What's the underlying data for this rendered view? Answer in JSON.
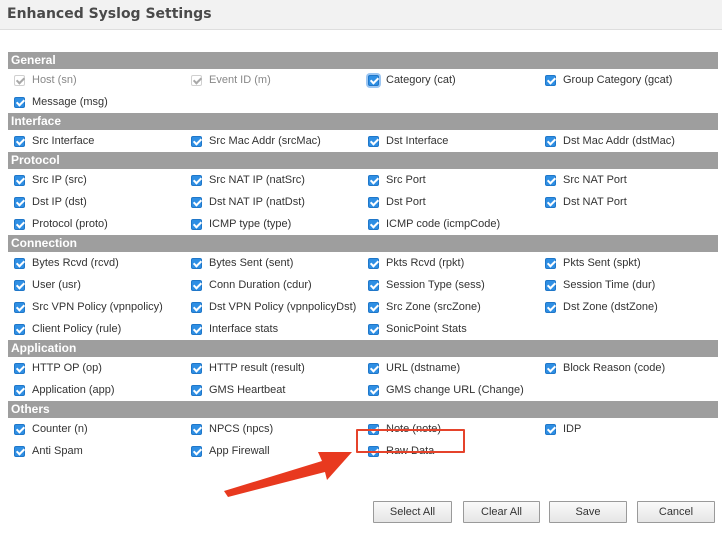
{
  "window": {
    "title": "Enhanced Syslog Settings"
  },
  "colors": {
    "accent": "#2f8fe4",
    "section_header": "#9e9e9e",
    "highlight": "#e5432b"
  },
  "sections": [
    {
      "name": "General",
      "rows": [
        [
          {
            "label": "Host (sn)",
            "checked": true,
            "disabled": true
          },
          {
            "label": "Event ID (m)",
            "checked": true,
            "disabled": true
          },
          {
            "label": "Category (cat)",
            "checked": true,
            "focused": true
          },
          {
            "label": "Group Category (gcat)",
            "checked": true
          }
        ],
        [
          {
            "label": "Message (msg)",
            "checked": true
          }
        ]
      ]
    },
    {
      "name": "Interface",
      "rows": [
        [
          {
            "label": "Src Interface",
            "checked": true
          },
          {
            "label": "Src Mac Addr (srcMac)",
            "checked": true
          },
          {
            "label": "Dst Interface",
            "checked": true
          },
          {
            "label": "Dst Mac Addr (dstMac)",
            "checked": true
          }
        ]
      ]
    },
    {
      "name": "Protocol",
      "rows": [
        [
          {
            "label": "Src IP (src)",
            "checked": true
          },
          {
            "label": "Src NAT IP (natSrc)",
            "checked": true
          },
          {
            "label": "Src Port",
            "checked": true
          },
          {
            "label": "Src NAT Port",
            "checked": true
          }
        ],
        [
          {
            "label": "Dst IP (dst)",
            "checked": true
          },
          {
            "label": "Dst NAT IP (natDst)",
            "checked": true
          },
          {
            "label": "Dst Port",
            "checked": true
          },
          {
            "label": "Dst NAT Port",
            "checked": true
          }
        ],
        [
          {
            "label": "Protocol (proto)",
            "checked": true
          },
          {
            "label": "ICMP type (type)",
            "checked": true
          },
          {
            "label": "ICMP code (icmpCode)",
            "checked": true
          }
        ]
      ]
    },
    {
      "name": "Connection",
      "rows": [
        [
          {
            "label": "Bytes Rcvd (rcvd)",
            "checked": true
          },
          {
            "label": "Bytes Sent (sent)",
            "checked": true
          },
          {
            "label": "Pkts Rcvd (rpkt)",
            "checked": true
          },
          {
            "label": "Pkts Sent (spkt)",
            "checked": true
          }
        ],
        [
          {
            "label": "User (usr)",
            "checked": true
          },
          {
            "label": "Conn Duration (cdur)",
            "checked": true
          },
          {
            "label": "Session Type (sess)",
            "checked": true
          },
          {
            "label": "Session Time (dur)",
            "checked": true
          }
        ],
        [
          {
            "label": "Src VPN Policy (vpnpolicy)",
            "checked": true
          },
          {
            "label": "Dst VPN Policy (vpnpolicyDst)",
            "checked": true
          },
          {
            "label": "Src Zone (srcZone)",
            "checked": true
          },
          {
            "label": "Dst Zone (dstZone)",
            "checked": true
          }
        ],
        [
          {
            "label": "Client Policy (rule)",
            "checked": true
          },
          {
            "label": "Interface stats",
            "checked": true
          },
          {
            "label": "SonicPoint Stats",
            "checked": true
          }
        ]
      ]
    },
    {
      "name": "Application",
      "rows": [
        [
          {
            "label": "HTTP OP (op)",
            "checked": true
          },
          {
            "label": "HTTP result (result)",
            "checked": true
          },
          {
            "label": "URL (dstname)",
            "checked": true
          },
          {
            "label": "Block Reason (code)",
            "checked": true
          }
        ],
        [
          {
            "label": "Application (app)",
            "checked": true
          },
          {
            "label": "GMS Heartbeat",
            "checked": true
          },
          {
            "label": "GMS change URL (Change)",
            "checked": true
          }
        ]
      ]
    },
    {
      "name": "Others",
      "rows": [
        [
          {
            "label": "Counter (n)",
            "checked": true
          },
          {
            "label": "NPCS (npcs)",
            "checked": true
          },
          {
            "label": "Note (note)",
            "checked": true,
            "highlighted": true
          },
          {
            "label": "IDP",
            "checked": true
          }
        ],
        [
          {
            "label": "Anti Spam",
            "checked": true
          },
          {
            "label": "App Firewall",
            "checked": true
          },
          {
            "label": "Raw Data",
            "checked": true
          }
        ]
      ]
    }
  ],
  "buttons": {
    "select_all": "Select All",
    "clear_all": "Clear All",
    "save": "Save",
    "cancel": "Cancel"
  }
}
